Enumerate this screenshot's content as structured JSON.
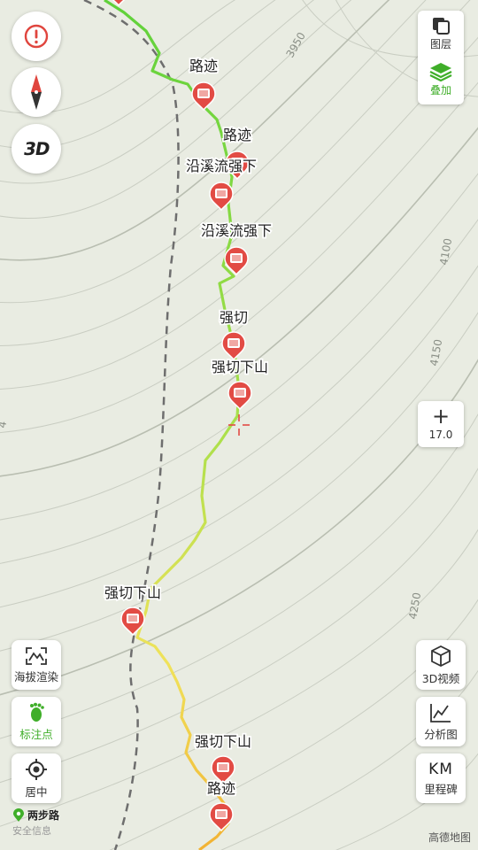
{
  "map": {
    "contour_labels": [
      "3950",
      "4100",
      "4150",
      "4250",
      "4"
    ],
    "waypoints": [
      {
        "label": "路迹"
      },
      {
        "label": "路迹"
      },
      {
        "label": "沿溪流强下"
      },
      {
        "label": "沿溪流强下"
      },
      {
        "label": "强切"
      },
      {
        "label": "强切下山"
      },
      {
        "label": "强切下山"
      },
      {
        "label": "强切下山"
      },
      {
        "label": "路迹"
      }
    ]
  },
  "layers": {
    "layers_label": "图层",
    "overlay_label": "叠加",
    "accent": "#3fae29"
  },
  "zoom": {
    "plus": "+",
    "level": "17.0"
  },
  "left_tools": [
    {
      "label": "海拔渲染"
    },
    {
      "label": "标注点"
    },
    {
      "label": "居中"
    }
  ],
  "right_tools": [
    {
      "label": "3D视频"
    },
    {
      "label": "分析图"
    },
    {
      "label": "里程碑",
      "icon_text": "KM"
    }
  ],
  "top_buttons": {
    "three_d": "3D"
  },
  "brand": {
    "name": "两步路",
    "sub": "安全信息"
  },
  "credit": "高德地图",
  "colors": {
    "marker": "#e0453e",
    "track_green": "#6ed13a",
    "track_yellow": "#e7e25a",
    "dashed": "#707070"
  }
}
